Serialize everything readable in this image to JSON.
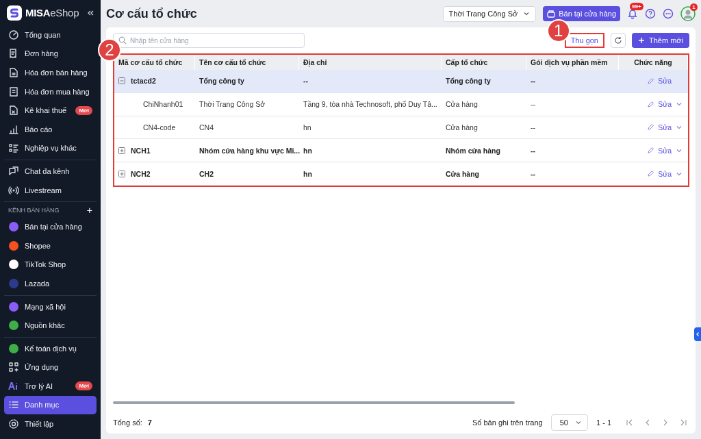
{
  "sidebar": {
    "brand": {
      "name": "MISA",
      "suffix": "eShop"
    },
    "groups": [
      {
        "items": [
          {
            "label": "Tổng quan",
            "selected": false
          },
          {
            "label": "Đơn hàng",
            "selected": false
          },
          {
            "label": "Hóa đơn bán hàng",
            "selected": false
          },
          {
            "label": "Hóa đơn mua hàng",
            "selected": false
          },
          {
            "label": "Kê khai thuế",
            "badge": "Mới",
            "selected": false
          },
          {
            "label": "Báo cáo",
            "selected": false
          },
          {
            "label": "Nghiệp vụ khác",
            "selected": false
          }
        ]
      },
      {
        "items": [
          {
            "label": "Chat đa kênh",
            "selected": false
          },
          {
            "label": "Livestream",
            "selected": false
          }
        ]
      },
      {
        "title": "KÊNH BÁN HÀNG",
        "add": "+",
        "items": [
          {
            "label": "Bán tại cửa hàng",
            "color": "#8b5cf6",
            "selected": false
          },
          {
            "label": "Shopee",
            "color": "#f4511e",
            "selected": false
          },
          {
            "label": "TikTok Shop",
            "color": "#ffffff",
            "selected": false
          },
          {
            "label": "Lazada",
            "color": "#2b3a8c",
            "selected": false
          }
        ]
      },
      {
        "items": [
          {
            "label": "Mạng xã hội",
            "color": "#8b5cf6",
            "selected": false
          },
          {
            "label": "Nguồn khác",
            "color": "#3fae49",
            "selected": false
          }
        ]
      },
      {
        "items": [
          {
            "label": "Kế toán dịch vụ",
            "color": "#3fae49",
            "selected": false
          },
          {
            "label": "Ứng dụng",
            "selected": false
          },
          {
            "label": "Trợ lý AI",
            "badge": "Mới",
            "selected": false
          },
          {
            "label": "Danh mục",
            "selected": true
          },
          {
            "label": "Thiết lập",
            "selected": false
          }
        ]
      }
    ]
  },
  "header": {
    "title": "Cơ cấu tổ chức",
    "store_select": "Thời Trang Công Sở",
    "pos_button": "Bán tại cửa hàng",
    "notification_count": "99+",
    "avatar_badge": "1"
  },
  "toolbar": {
    "search": {
      "placeholder": "Nhập tên cửa hàng"
    },
    "collapse_button": {
      "label": "Thu gọn",
      "callout": "1"
    },
    "add_button": "Thêm mới"
  },
  "table": {
    "callout": "2",
    "columns": [
      "Mã cơ cấu tổ chức",
      "Tên cơ cấu tổ chức",
      "Địa chỉ",
      "Cấp tổ chức",
      "Gói dịch vụ phần mềm",
      "Chức năng"
    ],
    "rows": [
      {
        "kind": "group",
        "code": "tctacd2",
        "name": "Tổng công ty",
        "address": "--",
        "level": "Tổng công ty",
        "package": "--",
        "action": "Sửa",
        "menu": false,
        "selected": true,
        "expanded": true,
        "children": [
          {
            "kind": "store",
            "code": "ChiNhanh01",
            "name": "Thời Trang Công Sở",
            "address": "Tầng 9, tòa nhà Technosoft, phố Duy Tâ...",
            "level": "Cửa hàng",
            "package": "--",
            "action": "Sửa",
            "menu": true,
            "selected": false
          },
          {
            "kind": "store",
            "code": "CN4-code",
            "name": "CN4",
            "address": "hn",
            "level": "Cửa hàng",
            "package": "--",
            "action": "Sửa",
            "menu": true,
            "selected": false
          }
        ]
      },
      {
        "kind": "group",
        "code": "NCH1",
        "name": "Nhóm cửa hàng khu vực Mi...",
        "address": "hn",
        "level": "Nhóm cửa hàng",
        "package": "--",
        "action": "Sửa",
        "menu": true,
        "selected": false,
        "expanded": false
      },
      {
        "kind": "group",
        "code": "NCH2",
        "name": "CH2",
        "address": "hn",
        "level": "Cửa hàng",
        "package": "--",
        "action": "Sửa",
        "menu": true,
        "selected": false,
        "expanded": false
      }
    ]
  },
  "footer": {
    "total_label": "Tổng số:",
    "total": "7",
    "page_size_label": "Số bản ghi trên trang",
    "page_size": "50",
    "range": "1 - 1"
  }
}
